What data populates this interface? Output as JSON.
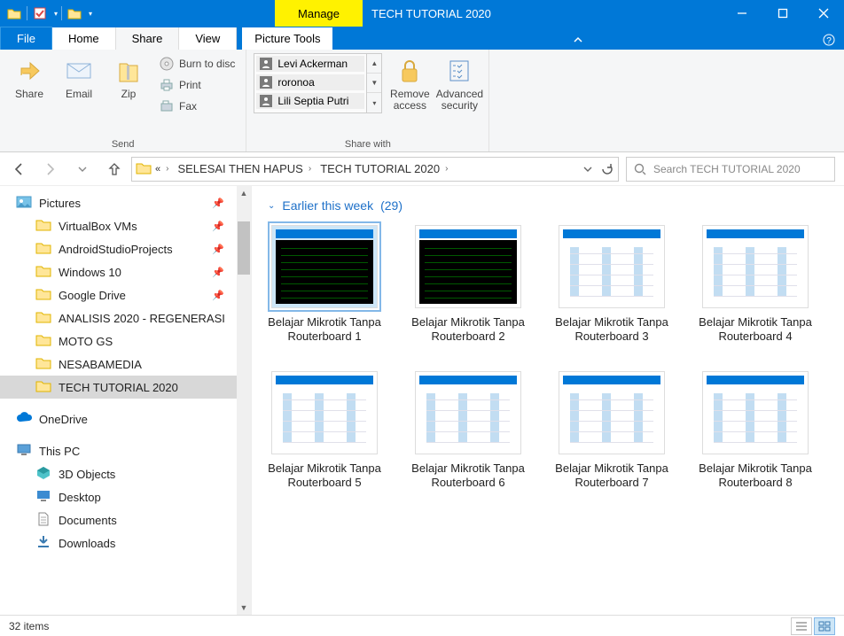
{
  "title": "TECH TUTORIAL 2020",
  "context_tab": "Manage",
  "tools_tab": "Picture Tools",
  "ribbon_tabs": {
    "file": "File",
    "home": "Home",
    "share": "Share",
    "view": "View"
  },
  "ribbon": {
    "send": {
      "share": "Share",
      "email": "Email",
      "zip": "Zip",
      "burn": "Burn to disc",
      "print": "Print",
      "fax": "Fax",
      "group": "Send"
    },
    "sharewith": {
      "users": [
        "Levi Ackerman",
        "roronoa",
        "Lili Septia Putri"
      ],
      "remove": "Remove access",
      "advanced": "Advanced security",
      "group": "Share with"
    }
  },
  "breadcrumb": {
    "parent": "SELESAI THEN HAPUS",
    "current": "TECH TUTORIAL 2020"
  },
  "search": {
    "placeholder": "Search TECH TUTORIAL 2020"
  },
  "nav": {
    "pictures": "Pictures",
    "items": [
      "VirtualBox VMs",
      "AndroidStudioProjects",
      "Windows 10",
      "Google Drive",
      "ANALISIS 2020 - REGENERASI",
      "MOTO GS",
      "NESABAMEDIA",
      "TECH TUTORIAL 2020"
    ],
    "onedrive": "OneDrive",
    "thispc": "This PC",
    "pcitems": [
      "3D Objects",
      "Desktop",
      "Documents",
      "Downloads"
    ]
  },
  "group_header": {
    "label": "Earlier this week",
    "count": "(29)"
  },
  "files": [
    {
      "name": "Belajar Mikrotik Tanpa Routerboard 1",
      "thumb": "dark",
      "selected": true
    },
    {
      "name": "Belajar Mikrotik Tanpa Routerboard 2",
      "thumb": "dark"
    },
    {
      "name": "Belajar Mikrotik Tanpa Routerboard 3",
      "thumb": "light"
    },
    {
      "name": "Belajar Mikrotik Tanpa Routerboard 4",
      "thumb": "light"
    },
    {
      "name": "Belajar Mikrotik Tanpa Routerboard 5",
      "thumb": "light"
    },
    {
      "name": "Belajar Mikrotik Tanpa Routerboard 6",
      "thumb": "light"
    },
    {
      "name": "Belajar Mikrotik Tanpa Routerboard 7",
      "thumb": "light"
    },
    {
      "name": "Belajar Mikrotik Tanpa Routerboard 8",
      "thumb": "light"
    }
  ],
  "status": {
    "count": "32 items"
  }
}
